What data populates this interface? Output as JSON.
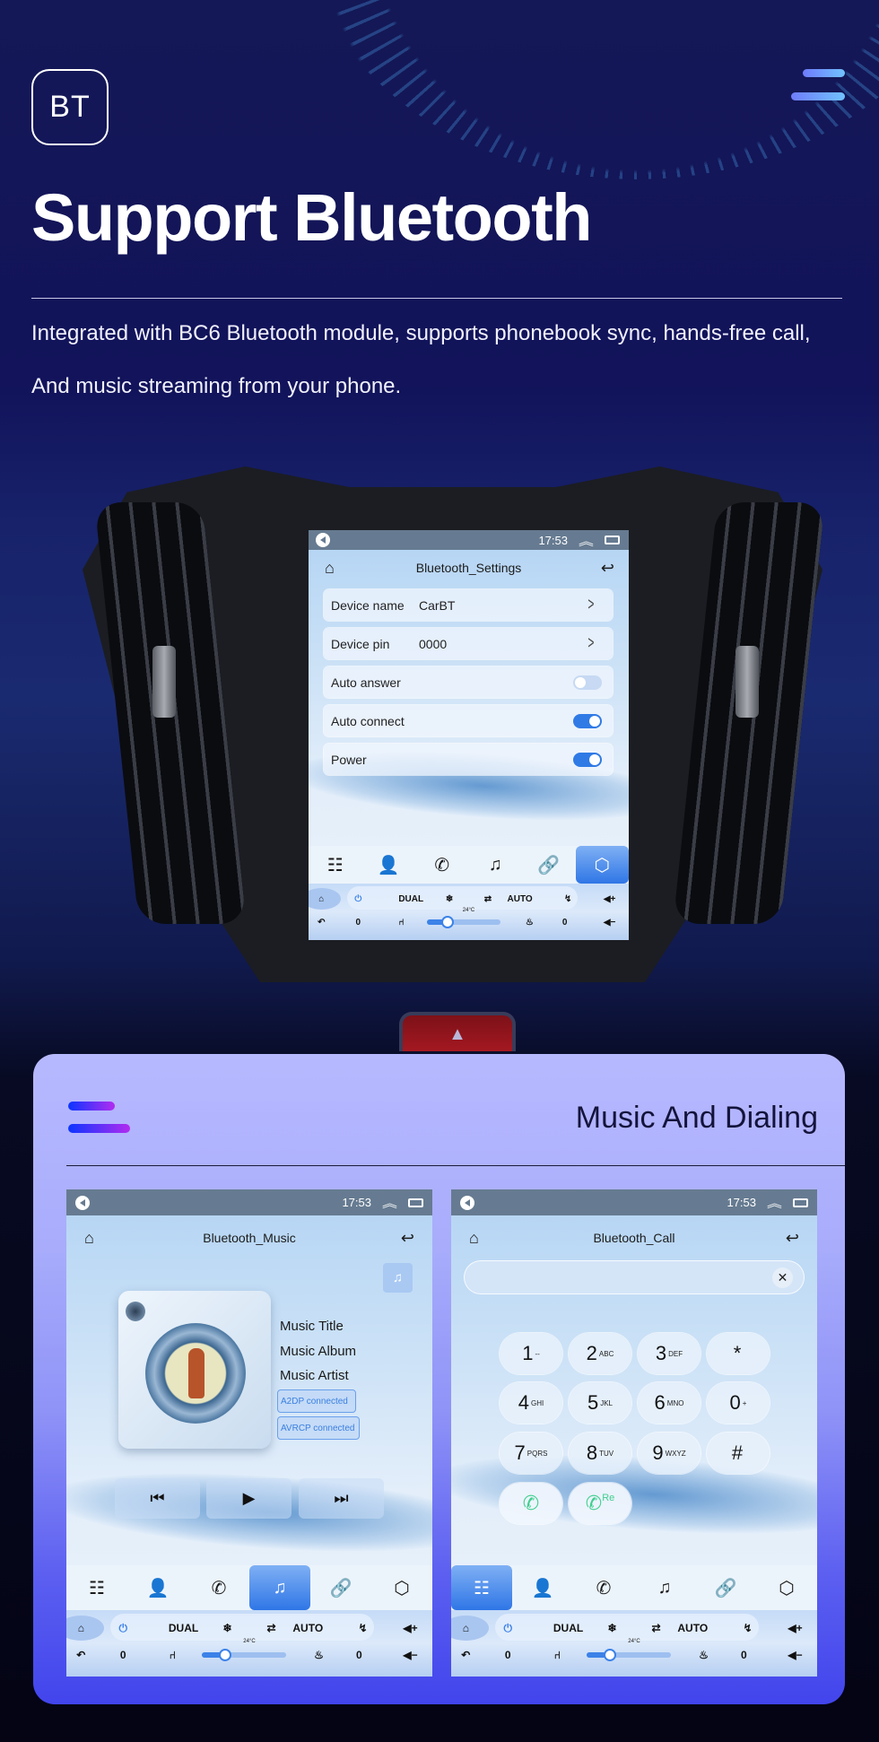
{
  "hero": {
    "badge": "BT",
    "title": "Support Bluetooth",
    "description_lines": [
      "Integrated with BC6 Bluetooth module, supports phonebook sync, hands-free call,",
      "And music streaming from your phone."
    ],
    "menu_icon": "hamburger-icon"
  },
  "status_bar": {
    "time": "17:53",
    "icons": [
      "volume-icon",
      "double-chevron-up-icon",
      "window-icon"
    ]
  },
  "settings_screen": {
    "title": "Bluetooth_Settings",
    "rows": [
      {
        "label": "Device name",
        "value": "CarBT",
        "type": "link"
      },
      {
        "label": "Device pin",
        "value": "0000",
        "type": "link"
      },
      {
        "label": "Auto answer",
        "type": "toggle",
        "on": false
      },
      {
        "label": "Auto connect",
        "type": "toggle",
        "on": true
      },
      {
        "label": "Power",
        "type": "toggle",
        "on": true
      }
    ],
    "active_tab": "settings"
  },
  "tabs": [
    {
      "name": "dialpad",
      "icon": "☷"
    },
    {
      "name": "contacts",
      "icon": "👤"
    },
    {
      "name": "call-log",
      "icon": "✆"
    },
    {
      "name": "music",
      "icon": "♫"
    },
    {
      "name": "pairing",
      "icon": "🔗"
    },
    {
      "name": "settings",
      "icon": "⬡"
    }
  ],
  "climate": {
    "dual": "DUAL",
    "auto": "AUTO",
    "temp": "24°C",
    "left_seat_value": "0",
    "right_seat_value": "0",
    "fan_level_fraction": 0.28,
    "accent": "#3c82e8"
  },
  "section": {
    "title": "Music And Dialing"
  },
  "music_screen": {
    "title": "Bluetooth_Music",
    "track_title": "Music Title",
    "album": "Music Album",
    "artist": "Music Artist",
    "badges": [
      "A2DP  connected",
      "AVRCP connected"
    ],
    "controls": [
      "previous",
      "play",
      "next"
    ],
    "active_tab": "music"
  },
  "call_screen": {
    "title": "Bluetooth_Call",
    "input_value": "",
    "keys": [
      {
        "d": "1",
        "s": "--"
      },
      {
        "d": "2",
        "s": "ABC"
      },
      {
        "d": "3",
        "s": "DEF"
      },
      {
        "d": "*",
        "s": ""
      },
      {
        "d": "4",
        "s": "GHI"
      },
      {
        "d": "5",
        "s": "JKL"
      },
      {
        "d": "6",
        "s": "MNO"
      },
      {
        "d": "0",
        "s": "+"
      },
      {
        "d": "7",
        "s": "PQRS"
      },
      {
        "d": "8",
        "s": "TUV"
      },
      {
        "d": "9",
        "s": "WXYZ"
      },
      {
        "d": "#",
        "s": ""
      }
    ],
    "call_button_label": "",
    "redial_label": "Re",
    "call_color": "#3fcf8e",
    "active_tab": "dialpad"
  }
}
